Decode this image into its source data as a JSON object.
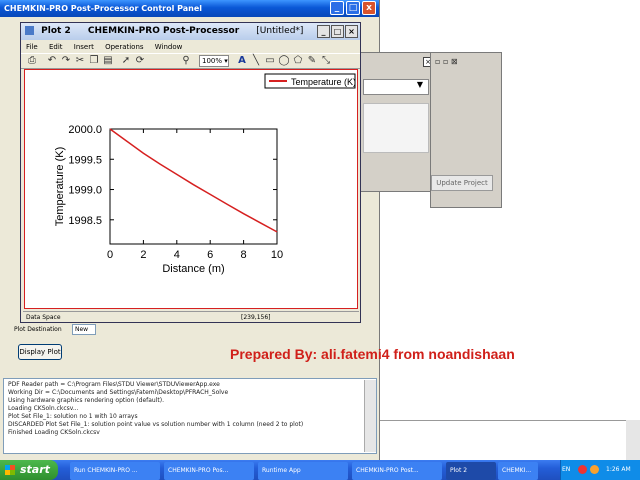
{
  "control_panel": {
    "title": "CHEMKIN-PRO Post-Processor Control Panel",
    "plot_destination_label": "Plot Destination",
    "plot_destination_value": "New",
    "display_plot_button": "Display Plot",
    "update_project_button": "Update Project"
  },
  "plot_window": {
    "title": "Plot 2",
    "app_title": "CHEMKIN-PRO Post-Processor",
    "doc_title": "[Untitled*]",
    "menu": [
      "File",
      "Edit",
      "Insert",
      "Operations",
      "Window"
    ],
    "zoom": "100%",
    "status_left": "Data Space",
    "status_right": "[239,156]"
  },
  "chart_data": {
    "type": "line",
    "title": "",
    "xlabel": "Distance (m)",
    "ylabel": "Temperature (K)",
    "xlim": [
      0,
      10
    ],
    "ylim": [
      1998.1,
      2000.0
    ],
    "xticks": [
      0,
      2,
      4,
      6,
      8,
      10
    ],
    "yticks": [
      1998.5,
      1999.0,
      1999.5,
      2000.0
    ],
    "ytick_labels": [
      "1998.5",
      "1999.0",
      "1999.5",
      "2000.0"
    ],
    "legend": "top-right",
    "series": [
      {
        "name": "Temperature (K)",
        "color": "#d62020",
        "x": [
          0,
          1,
          2,
          3,
          4,
          5,
          6,
          7,
          8,
          9,
          10
        ],
        "y": [
          2000.0,
          1999.8,
          1999.6,
          1999.42,
          1999.25,
          1999.08,
          1998.92,
          1998.76,
          1998.6,
          1998.45,
          1998.3
        ]
      }
    ]
  },
  "watermark": "Prepared By: ali.fatemi4 from noandishaan",
  "log": [
    "PDF Reader path = C:\\Program Files\\STDU Viewer\\STDUViewerApp.exe",
    "Working Dir = C:\\Documents and Settings\\Fatemi\\Desktop\\PFRACH_Solve",
    "Using hardware graphics rendering option (default).",
    "Loading CKSoln.ckcsv...",
    "Plot Set      File_1: solution no 1 with     10 arrays",
    "DISCARDED Plot Set File_1: solution point value vs solution number with     1 column (need 2 to plot)",
    "Finished Loading CKSoln.ckcsv"
  ],
  "taskbar": {
    "start": "start",
    "items": [
      "Run CHEMKIN-PRO ...",
      "CHEMKIN-PRO Pos...",
      "Runtime App",
      "CHEMKIN-PRO Post...",
      "Plot 2",
      "CHEMKI..."
    ],
    "lang": "EN",
    "clock": "1:26 AM"
  },
  "colors": {
    "plot_border": "#d62020",
    "title_blue": "#0a57d6"
  }
}
